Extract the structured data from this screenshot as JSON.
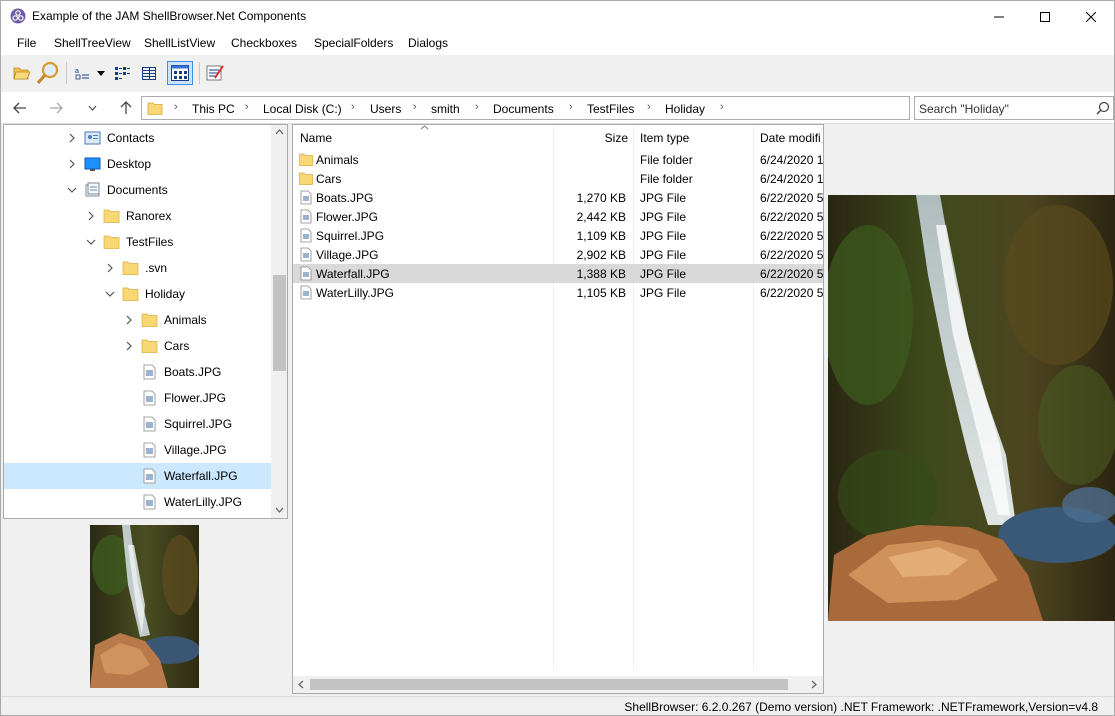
{
  "window": {
    "title": "Example of the JAM ShellBrowser.Net Components"
  },
  "menu": [
    "File",
    "ShellTreeView",
    "ShellListView",
    "Checkboxes",
    "SpecialFolders",
    "Dialogs"
  ],
  "address": {
    "breadcrumbs": [
      "This PC",
      "Local Disk (C:)",
      "Users",
      "smith",
      "Documents",
      "TestFiles",
      "Holiday"
    ],
    "search_placeholder": "Search  \"Holiday\""
  },
  "tree": [
    {
      "label": "Contacts",
      "icon": "contacts-icon",
      "chevron": "right"
    },
    {
      "label": "Desktop",
      "icon": "desktop-icon",
      "chevron": "right"
    },
    {
      "label": "Documents",
      "icon": "documents-icon",
      "chevron": "down"
    },
    {
      "label": "Ranorex",
      "icon": "folder-icon",
      "chevron": "right"
    },
    {
      "label": "TestFiles",
      "icon": "folder-icon",
      "chevron": "down"
    },
    {
      "label": ".svn",
      "icon": "folder-icon",
      "chevron": "right"
    },
    {
      "label": "Holiday",
      "icon": "folder-icon",
      "chevron": "down"
    },
    {
      "label": "Animals",
      "icon": "folder-icon",
      "chevron": "right"
    },
    {
      "label": "Cars",
      "icon": "folder-icon",
      "chevron": "right"
    },
    {
      "label": "Boats.JPG",
      "icon": "image-file-icon",
      "chevron": ""
    },
    {
      "label": "Flower.JPG",
      "icon": "image-file-icon",
      "chevron": ""
    },
    {
      "label": "Squirrel.JPG",
      "icon": "image-file-icon",
      "chevron": ""
    },
    {
      "label": "Village.JPG",
      "icon": "image-file-icon",
      "chevron": ""
    },
    {
      "label": "Waterfall.JPG",
      "icon": "image-file-icon",
      "chevron": "",
      "selected": true
    },
    {
      "label": "WaterLilly.JPG",
      "icon": "image-file-icon",
      "chevron": ""
    }
  ],
  "list": {
    "columns": [
      "Name",
      "Size",
      "Item type",
      "Date modifi"
    ],
    "rows": [
      {
        "name": "Animals",
        "size": "",
        "type": "File folder",
        "date": "6/24/2020 1",
        "icon": "folder-icon"
      },
      {
        "name": "Cars",
        "size": "",
        "type": "File folder",
        "date": "6/24/2020 1",
        "icon": "folder-icon"
      },
      {
        "name": "Boats.JPG",
        "size": "1,270 KB",
        "type": "JPG File",
        "date": "6/22/2020 5",
        "icon": "image-file-icon"
      },
      {
        "name": "Flower.JPG",
        "size": "2,442 KB",
        "type": "JPG File",
        "date": "6/22/2020 5",
        "icon": "image-file-icon"
      },
      {
        "name": "Squirrel.JPG",
        "size": "1,109 KB",
        "type": "JPG File",
        "date": "6/22/2020 5",
        "icon": "image-file-icon"
      },
      {
        "name": "Village.JPG",
        "size": "2,902 KB",
        "type": "JPG File",
        "date": "6/22/2020 5",
        "icon": "image-file-icon"
      },
      {
        "name": "Waterfall.JPG",
        "size": "1,388 KB",
        "type": "JPG File",
        "date": "6/22/2020 5",
        "icon": "image-file-icon",
        "selected": true
      },
      {
        "name": "WaterLilly.JPG",
        "size": "1,105 KB",
        "type": "JPG File",
        "date": "6/22/2020 5",
        "icon": "image-file-icon"
      }
    ]
  },
  "status": {
    "text": "ShellBrowser: 6.2.0.267 (Demo version) .NET Framework: .NETFramework,Version=v4.8"
  },
  "colors": {
    "tree_selection": "#cce8ff",
    "list_selection": "#d9d9d9",
    "folder": "#f8d775",
    "window_bg": "#f0f0f0"
  }
}
